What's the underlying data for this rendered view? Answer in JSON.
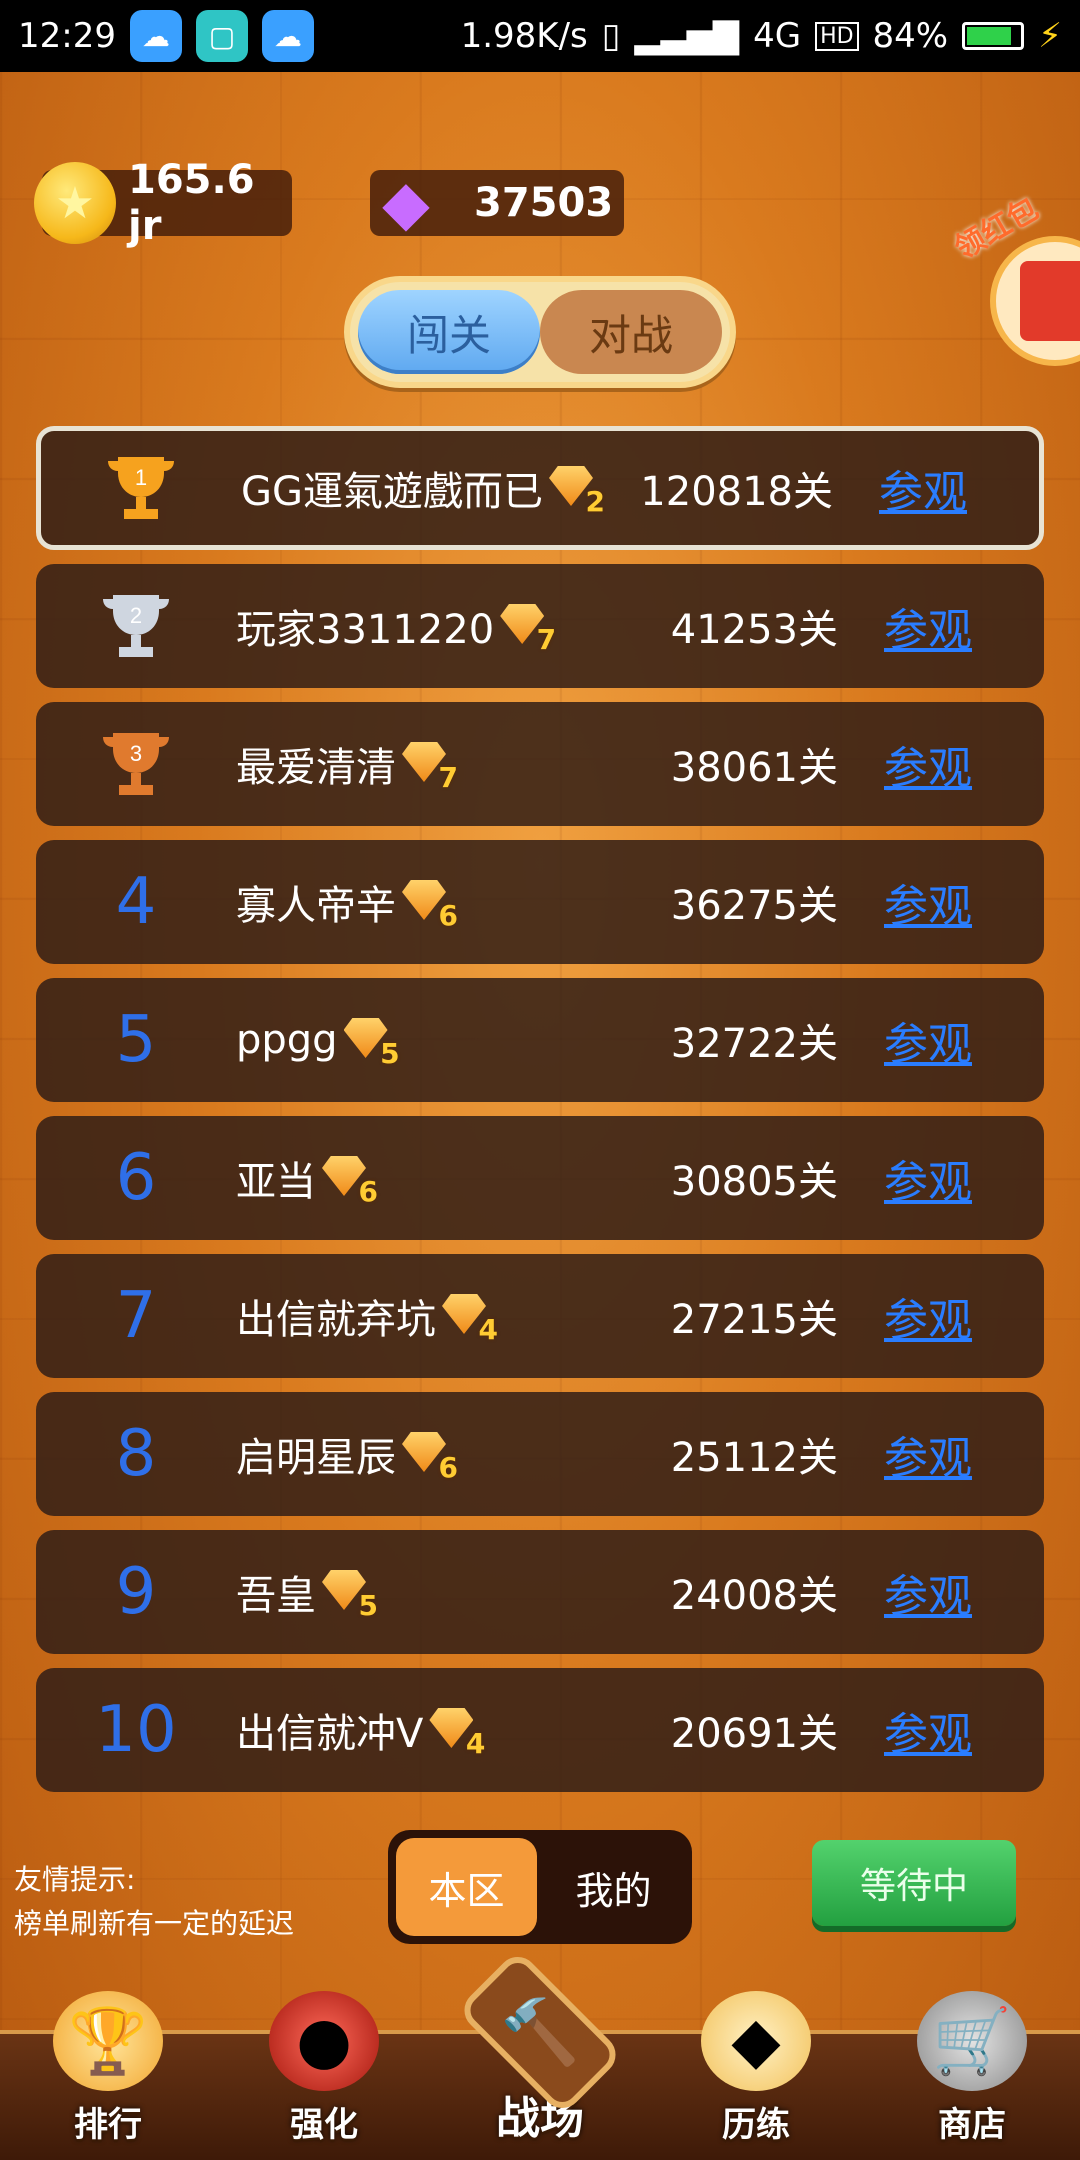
{
  "status_bar": {
    "time": "12:29",
    "speed": "1.98K/s",
    "network": "4G",
    "hd": "HD",
    "battery": "84%"
  },
  "currency": {
    "coins": "165.6 jr",
    "gems": "37503"
  },
  "mode_tabs": {
    "active": "闯关",
    "inactive": "对战"
  },
  "ranking": [
    {
      "rank": "1",
      "name": "GG運氣遊戲而已",
      "vip": "2",
      "level": "120818关",
      "action": "参观"
    },
    {
      "rank": "2",
      "name": "玩家3311220",
      "vip": "7",
      "level": "41253关",
      "action": "参观"
    },
    {
      "rank": "3",
      "name": "最爱清清",
      "vip": "7",
      "level": "38061关",
      "action": "参观"
    },
    {
      "rank": "4",
      "name": "寡人帝辛",
      "vip": "6",
      "level": "36275关",
      "action": "参观"
    },
    {
      "rank": "5",
      "name": "ppgg",
      "vip": "5",
      "level": "32722关",
      "action": "参观"
    },
    {
      "rank": "6",
      "name": "亚当",
      "vip": "6",
      "level": "30805关",
      "action": "参观"
    },
    {
      "rank": "7",
      "name": "出信就弃坑",
      "vip": "4",
      "level": "27215关",
      "action": "参观"
    },
    {
      "rank": "8",
      "name": "启明星辰",
      "vip": "6",
      "level": "25112关",
      "action": "参观"
    },
    {
      "rank": "9",
      "name": "吾皇",
      "vip": "5",
      "level": "24008关",
      "action": "参观"
    },
    {
      "rank": "10",
      "name": "出信就冲V",
      "vip": "4",
      "level": "20691关",
      "action": "参观"
    }
  ],
  "tips": {
    "line1": "友情提示:",
    "line2": "榜单刷新有一定的延迟"
  },
  "scope_tabs": {
    "active": "本区",
    "inactive": "我的"
  },
  "wait_button": "等待中",
  "bottom_nav": {
    "items": [
      "排行",
      "强化",
      "战场",
      "历练",
      "商店"
    ]
  }
}
